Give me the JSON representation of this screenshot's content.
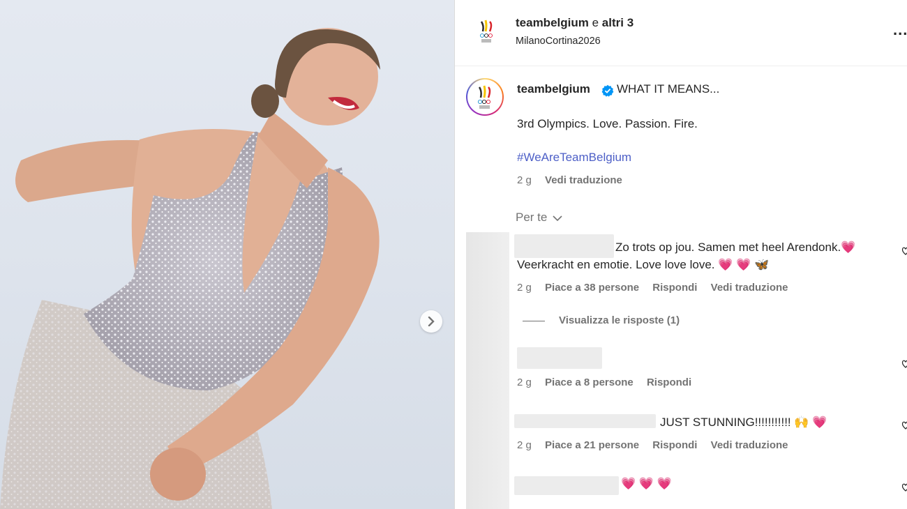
{
  "header": {
    "username": "teambelgium",
    "connector": "e",
    "others": "altri 3",
    "location": "MilanoCortina2026",
    "more_label": "..."
  },
  "caption": {
    "username": "teambelgium",
    "headline": "WHAT IT MEANS...",
    "line2": "3rd Olympics. Love. Passion. Fire.",
    "hashtag": "#WeAreTeamBelgium",
    "time": "2 g",
    "translate": "Vedi traduzione"
  },
  "sort": {
    "label": "Per te"
  },
  "comments": [
    {
      "line1": "Zo trots op jou. Samen met heel Arendonk.",
      "line2": "Veerkracht en emotie. Love love love.",
      "time": "2 g",
      "likes": "Piace a 38 persone",
      "reply": "Rispondi",
      "translate": "Vedi traduzione",
      "view_replies": "Visualizza le risposte (1)"
    },
    {
      "time": "2 g",
      "likes": "Piace a 8 persone",
      "reply": "Rispondi"
    },
    {
      "line1": "JUST STUNNING!!!!!!!!!!!",
      "time": "2 g",
      "likes": "Piace a 21 persone",
      "reply": "Rispondi",
      "translate": "Vedi traduzione"
    },
    {
      "line1": ""
    }
  ],
  "emoji": {
    "heart": "💗",
    "butterfly": "🦋",
    "pray": "🙌"
  },
  "colors": {
    "hashtag": "#4d5fc7",
    "verified": "#0095f6",
    "meta": "#737373"
  },
  "icons": [
    "verified-badge-icon",
    "chevron-down-icon",
    "chevron-right-icon",
    "heart-outline-icon",
    "more-icon"
  ]
}
